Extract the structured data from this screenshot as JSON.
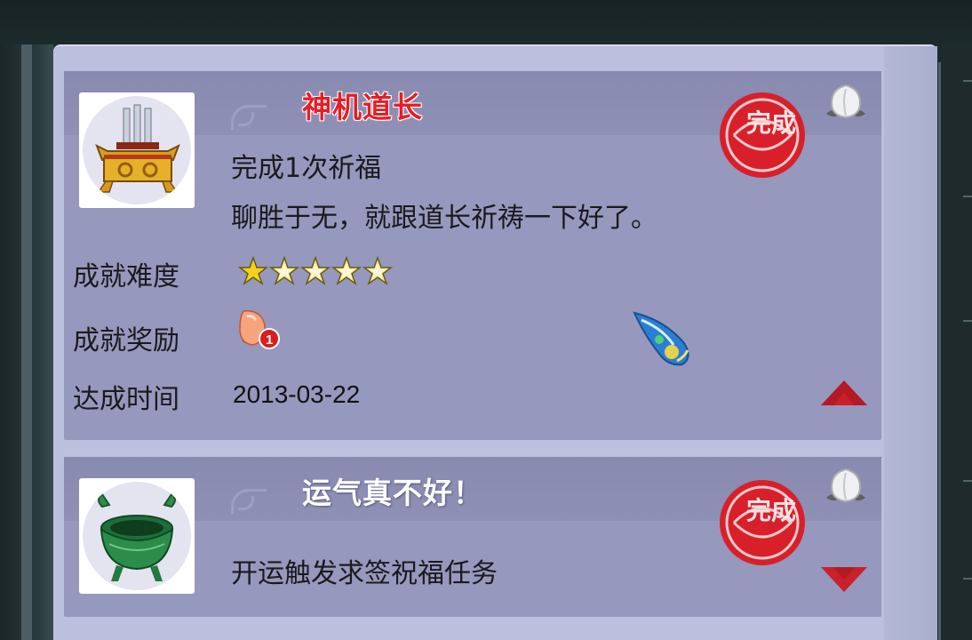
{
  "achievements": [
    {
      "title": "神机道长",
      "title_color": "#e81d25",
      "icon": "altar-icon",
      "lines": [
        "完成1次祈福",
        "聊胜于无，就跟道长祈祷一下好了。"
      ],
      "status_stamp": "完成",
      "reward_preview_icon": "white-peach-icon",
      "expanded": true,
      "details": {
        "difficulty_label": "成就难度",
        "difficulty_rating": 1,
        "difficulty_max": 5,
        "reward_label": "成就奖励",
        "reward_icon": "peach-icon",
        "reward_count": "1",
        "time_label": "达成时间",
        "time_value": "2013-03-22"
      },
      "toggle_icon": "collapse-arrow-icon"
    },
    {
      "title": "运气真不好！",
      "title_color": "#ffffff",
      "icon": "jade-cauldron-icon",
      "lines": [
        "开运触发求签祝福任务"
      ],
      "status_stamp": "完成",
      "reward_preview_icon": "white-peach-icon",
      "expanded": false,
      "toggle_icon": "expand-arrow-icon"
    }
  ],
  "colors": {
    "panel_bg": "#bcc0de",
    "card_bg": "#9698bd",
    "stamp_red": "#d8202a",
    "star_gold": "#f4d21c"
  }
}
